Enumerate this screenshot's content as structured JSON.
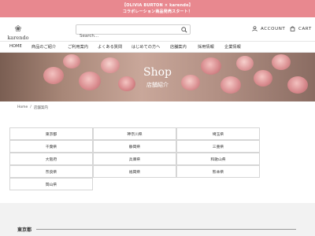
{
  "announcement": {
    "line1": "【OLIVIA BURTON × karendo】",
    "line2": "コラボレーション商品発売スタート！"
  },
  "brand": {
    "logo_text": "karendo"
  },
  "search": {
    "placeholder": "Search..."
  },
  "account": {
    "label": "ACCOUNT"
  },
  "cart": {
    "label": "CART"
  },
  "nav": {
    "items": [
      "HOME",
      "商品のご紹介",
      "ご利用案内",
      "よくある質問",
      "はじめての方へ",
      "店舗案内",
      "採用情報",
      "企業情報"
    ]
  },
  "hero": {
    "title": "Shop",
    "subtitle": "店舗紹介"
  },
  "breadcrumb": {
    "home": "Home",
    "separator": "/",
    "current": "店舗案内"
  },
  "regions": [
    "東京都",
    "神奈川県",
    "埼玉県",
    "千葉県",
    "静岡県",
    "三重県",
    "大阪府",
    "兵庫県",
    "和歌山県",
    "奈良県",
    "福岡県",
    "熊本県",
    "岡山県"
  ],
  "section": {
    "title": "東京都"
  },
  "colors": {
    "announce_bg": "#e8888f",
    "hero_tint": "#b28d80"
  }
}
